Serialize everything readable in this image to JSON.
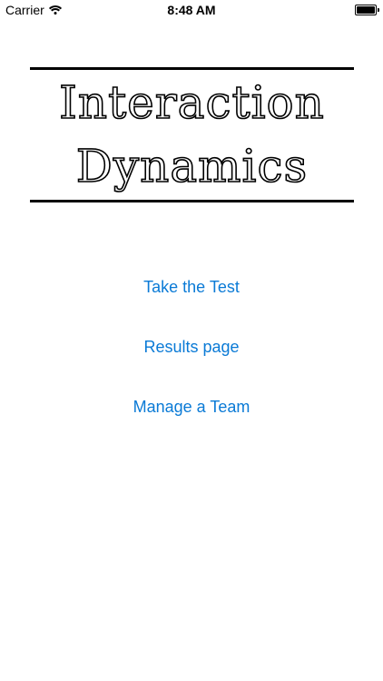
{
  "status_bar": {
    "carrier": "Carrier",
    "time": "8:48 AM",
    "wifi_icon": "wifi-icon",
    "battery_icon": "battery-icon",
    "battery_level": 1.0
  },
  "logo": {
    "line1": "Interaction",
    "line2": "Dynamics"
  },
  "menu": {
    "take_test": "Take the Test",
    "results": "Results page",
    "manage_team": "Manage a Team"
  },
  "colors": {
    "accent": "#0a7ad6",
    "background": "#ffffff"
  }
}
